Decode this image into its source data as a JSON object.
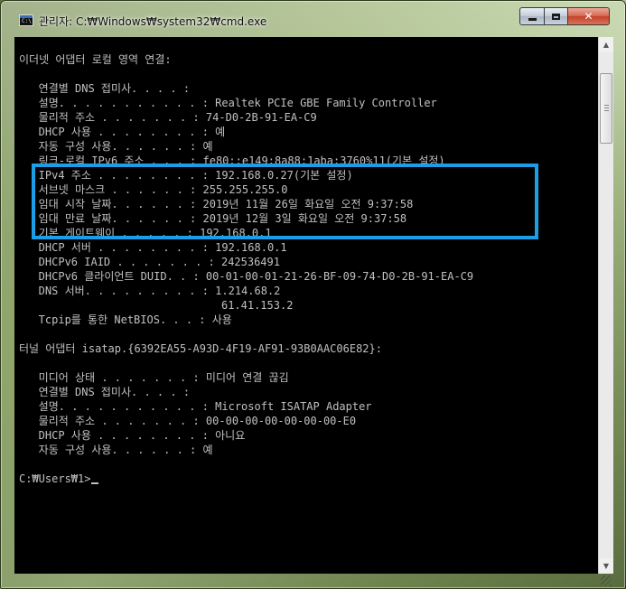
{
  "window": {
    "title": "관리자: C:₩Windows₩system32₩cmd.exe",
    "icon": "cmd-icon",
    "buttons": {
      "minimize": "minimize-icon",
      "maximize": "maximize-icon",
      "close": "✕"
    }
  },
  "console": {
    "foreground": "#c0c0c0",
    "background": "#000000",
    "highlight_color": "#1b9ee6",
    "lines": [
      "이더넷 어댑터 로컬 영역 연결:",
      "",
      "   연결별 DNS 접미사. . . . :",
      "   설명. . . . . . . . . . . : Realtek PCIe GBE Family Controller",
      "   물리적 주소 . . . . . . . : 74-D0-2B-91-EA-C9",
      "   DHCP 사용 . . . . . . . . : 예",
      "   자동 구성 사용. . . . . . : 예",
      "   링크-로컬 IPv6 주소 . . . : fe80::e149:8a88:1aba:3760%11(기본 설정)",
      "   IPv4 주소 . . . . . . . . : 192.168.0.27(기본 설정)",
      "   서브넷 마스크 . . . . . . : 255.255.255.0",
      "   임대 시작 날짜. . . . . . : 2019년 11월 26일 화요일 오전 9:37:58",
      "   임대 만료 날짜. . . . . . : 2019년 12월 3일 화요일 오전 9:37:58",
      "   기본 게이트웨이 . . . . . : 192.168.0.1",
      "   DHCP 서버 . . . . . . . . : 192.168.0.1",
      "   DHCPv6 IAID . . . . . . . : 242536491",
      "   DHCPv6 클라이언트 DUID. . : 00-01-00-01-21-26-BF-09-74-D0-2B-91-EA-C9",
      "   DNS 서버. . . . . . . . . : 1.214.68.2",
      "                               61.41.153.2",
      "   Tcpip를 통한 NetBIOS. . . : 사용",
      "",
      "터널 어댑터 isatap.{6392EA55-A93D-4F19-AF91-93B0AAC06E82}:",
      "",
      "   미디어 상태 . . . . . . . : 미디어 연결 끊김",
      "   연결별 DNS 접미사. . . . :",
      "   설명. . . . . . . . . . . : Microsoft ISATAP Adapter",
      "   물리적 주소 . . . . . . . : 00-00-00-00-00-00-00-E0",
      "   DHCP 사용 . . . . . . . . : 아니요",
      "   자동 구성 사용. . . . . . : 예",
      "",
      "C:₩Users₩1>"
    ]
  }
}
